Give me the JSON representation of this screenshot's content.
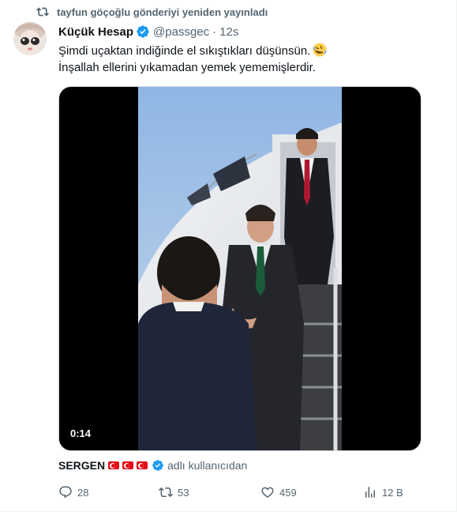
{
  "repost": {
    "text": "tayfun göçoğlu gönderiyi yeniden yayınladı",
    "icon": "repost-icon"
  },
  "author": {
    "name": "Küçük Hesap",
    "handle": "@passgec",
    "separator": "·",
    "time": "12s",
    "verified_color": "#1d9bf0"
  },
  "tweet": {
    "line1": "Şimdi uçaktan indiğinde el sıkıştıkları düşünsün.",
    "line2": "İnşallah ellerini yıkamadan yemek yememişlerdir.",
    "emoji": "rolling-on-the-floor-laughing-emoji"
  },
  "media": {
    "duration": "0:14"
  },
  "credit": {
    "name": "SERGEN",
    "flags": [
      "turkey-flag",
      "turkey-flag",
      "turkey-flag"
    ],
    "suffix": "adlı kullanıcıdan"
  },
  "actions": {
    "replies": "28",
    "reposts": "53",
    "likes": "459",
    "views": "12 B"
  },
  "colors": {
    "text": "#0f1419",
    "secondary": "#536471",
    "accent": "#1d9bf0"
  }
}
